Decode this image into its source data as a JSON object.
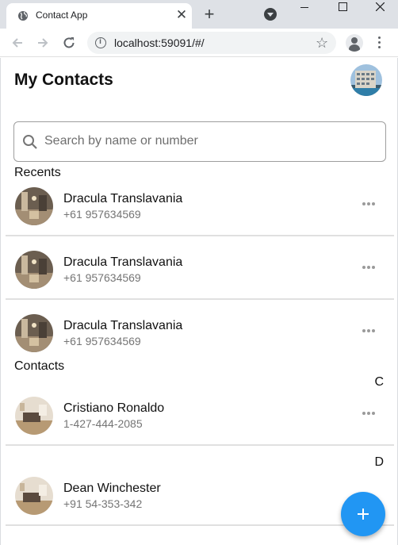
{
  "browser": {
    "tab_title": "Contact App",
    "url": "localhost:59091/#/",
    "icons": [
      "globe-icon",
      "close-icon",
      "plus-icon",
      "tab-search-icon",
      "minimize-icon",
      "maximize-icon",
      "window-close-icon",
      "back-arrow-icon",
      "forward-arrow-icon",
      "reload-icon",
      "info-icon",
      "star-icon",
      "profile-icon",
      "menu-icon"
    ]
  },
  "app": {
    "title": "My Contacts",
    "search_placeholder": "Search by name or number",
    "recents_label": "Recents",
    "contacts_label": "Contacts",
    "accent_color": "#2196f3",
    "recents": [
      {
        "name": "Dracula Translavania",
        "number": "+61 957634569",
        "avatar": "hallway-photo"
      },
      {
        "name": "Dracula Translavania",
        "number": "+61 957634569",
        "avatar": "hallway-photo"
      },
      {
        "name": "Dracula Translavania",
        "number": "+61 957634569",
        "avatar": "hallway-photo"
      }
    ],
    "groups": [
      {
        "letter": "C",
        "contacts": [
          {
            "name": "Cristiano Ronaldo",
            "number": "1-427-444-2085",
            "avatar": "room-photo"
          }
        ]
      },
      {
        "letter": "D",
        "contacts": [
          {
            "name": "Dean Winchester",
            "number": "+91 54-353-342",
            "avatar": "room-photo"
          }
        ]
      }
    ]
  }
}
